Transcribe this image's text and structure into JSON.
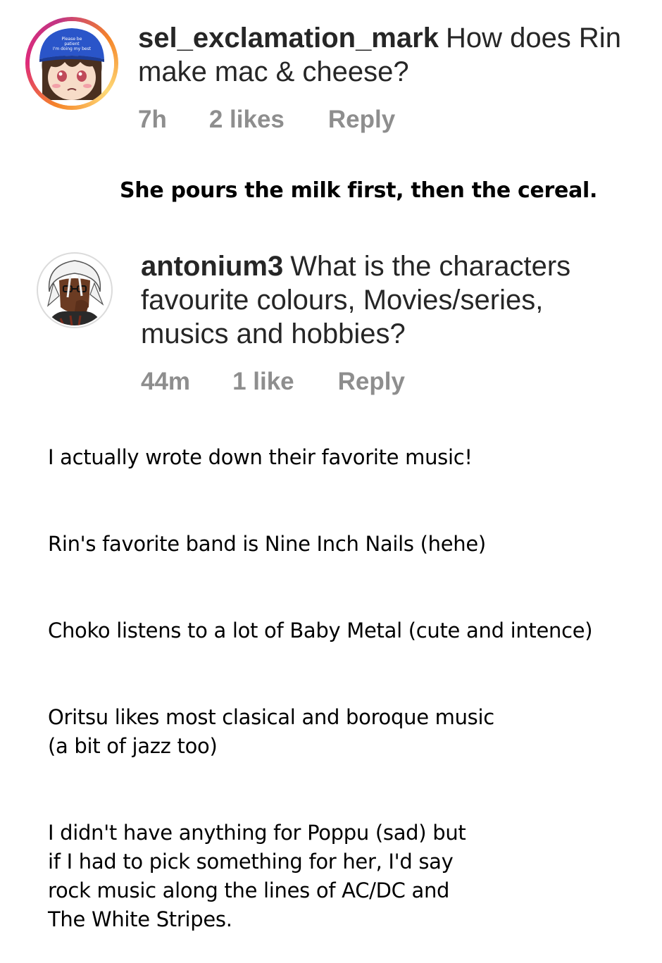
{
  "comments": [
    {
      "username": "sel_exclamation_mark",
      "text": "How does Rin make mac & cheese?",
      "time": "7h",
      "likes": "2 likes",
      "reply_label": "Reply",
      "avatar": {
        "icon": "anime-girl-blue-cap-avatar",
        "cap_text": "Please be patient I'm doing my best",
        "ring": "story-gradient"
      }
    },
    {
      "username": "antonium3",
      "text": "What is the characters favourite colours, Movies/series, musics and hobbies?",
      "time": "44m",
      "likes": "1 like",
      "reply_label": "Reply",
      "avatar": {
        "icon": "dark-character-avatar",
        "ring": "grey"
      }
    }
  ],
  "answers": {
    "first": "She pours the milk first, then the cereal.",
    "second": [
      "I actually wrote down their favorite music!",
      "Rin's favorite band is Nine Inch Nails (hehe)",
      "Choko listens to a lot of Baby Metal (cute and intence)",
      "Oritsu likes most clasical and boroque music\n(a bit of jazz too)",
      "I didn't have anything for Poppu (sad) but\nif I had to pick something for her, I'd say\nrock music along the lines of AC/DC and\nThe White Stripes."
    ]
  },
  "colors": {
    "text": "#262626",
    "meta": "#8e8e8e",
    "cap_blue": "#2a55c9",
    "story_ring_start": "#f58529",
    "story_ring_end": "#dd2a7b"
  }
}
